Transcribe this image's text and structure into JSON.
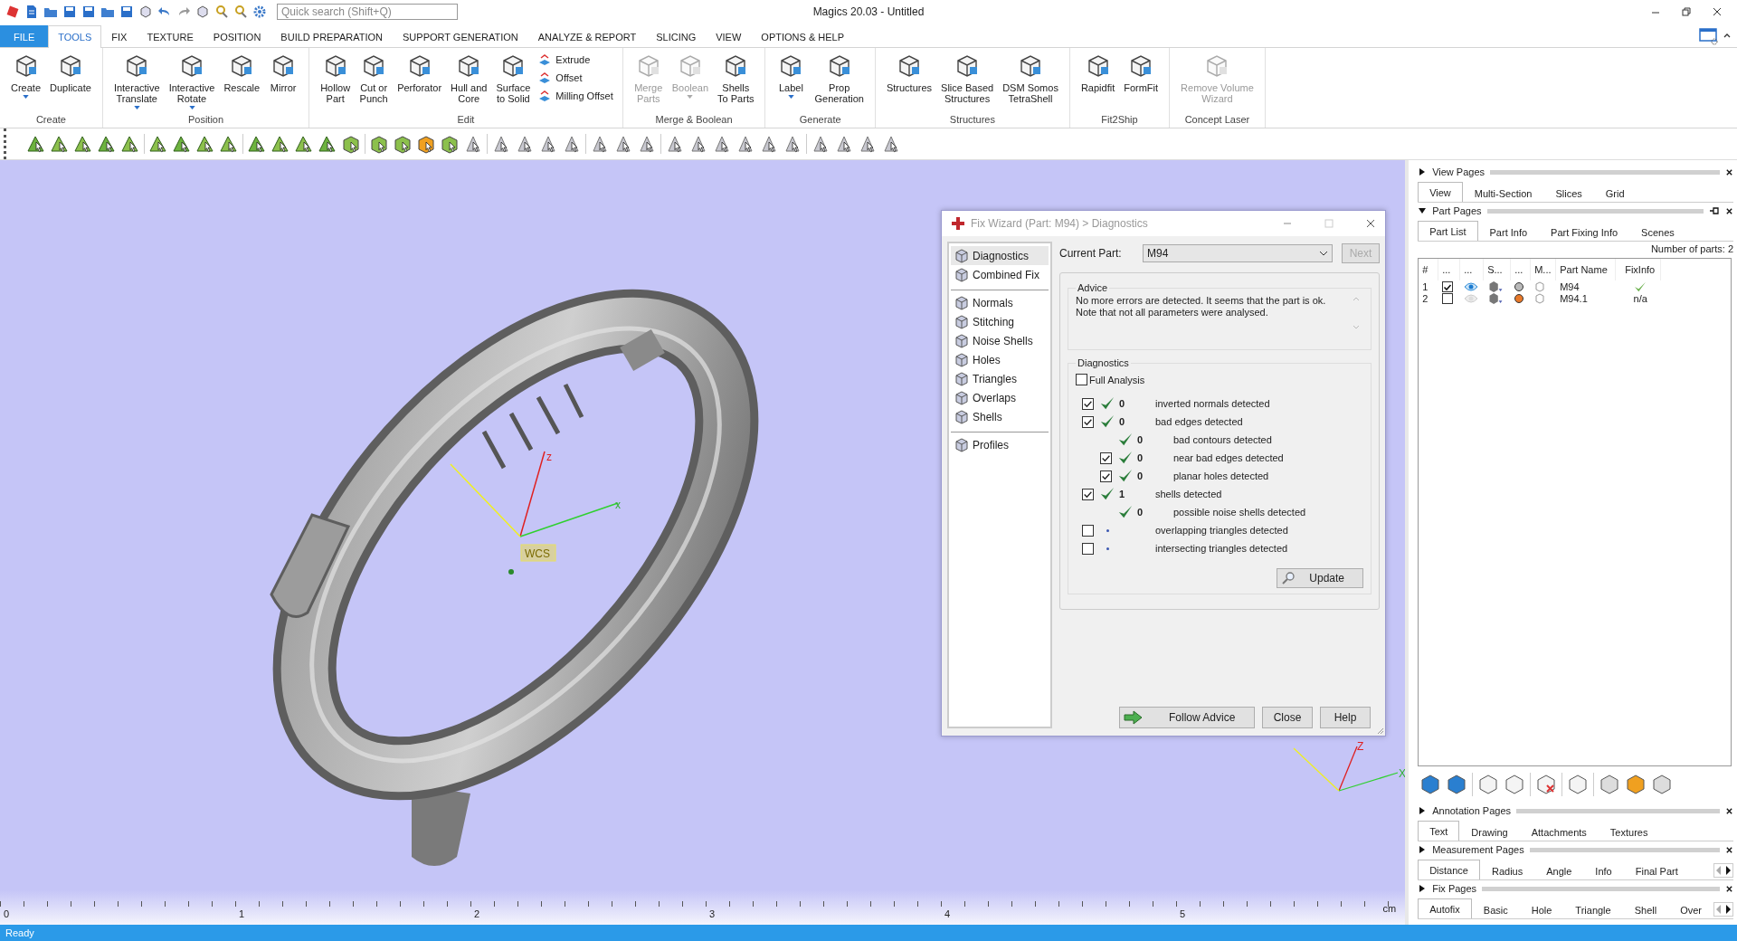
{
  "app": {
    "title": "Magics 20.03 - Untitled",
    "search": {
      "placeholder": "Quick search (Shift+Q)"
    }
  },
  "menu_tabs": [
    {
      "label": "FILE",
      "kind": "file",
      "selected": false
    },
    {
      "label": "TOOLS",
      "kind": "tab",
      "selected": true
    },
    {
      "label": "FIX",
      "kind": "tab",
      "selected": false
    },
    {
      "label": "TEXTURE",
      "kind": "tab",
      "selected": false
    },
    {
      "label": "POSITION",
      "kind": "tab",
      "selected": false
    },
    {
      "label": "BUILD PREPARATION",
      "kind": "tab",
      "selected": false
    },
    {
      "label": "SUPPORT GENERATION",
      "kind": "tab",
      "selected": false
    },
    {
      "label": "ANALYZE & REPORT",
      "kind": "tab",
      "selected": false
    },
    {
      "label": "SLICING",
      "kind": "tab",
      "selected": false
    },
    {
      "label": "VIEW",
      "kind": "tab",
      "selected": false
    },
    {
      "label": "OPTIONS & HELP",
      "kind": "tab",
      "selected": false
    }
  ],
  "ribbon": [
    {
      "label": "Create",
      "buttons": [
        {
          "lines": [
            "Create"
          ],
          "dropdown": true,
          "disabled": false
        },
        {
          "lines": [
            "Duplicate"
          ],
          "dropdown": false,
          "disabled": false
        }
      ]
    },
    {
      "label": "Position",
      "buttons": [
        {
          "lines": [
            "Interactive",
            "Translate"
          ],
          "dropdown": true,
          "disabled": false
        },
        {
          "lines": [
            "Interactive",
            "Rotate"
          ],
          "dropdown": true,
          "disabled": false
        },
        {
          "lines": [
            "Rescale"
          ],
          "dropdown": false,
          "disabled": false
        },
        {
          "lines": [
            "Mirror"
          ],
          "dropdown": false,
          "disabled": false
        }
      ]
    },
    {
      "label": "Edit",
      "buttons": [
        {
          "lines": [
            "Hollow",
            "Part"
          ],
          "dropdown": false,
          "disabled": false
        },
        {
          "lines": [
            "Cut or",
            "Punch"
          ],
          "dropdown": false,
          "disabled": false
        },
        {
          "lines": [
            "Perforator"
          ],
          "dropdown": false,
          "disabled": false
        },
        {
          "lines": [
            "Hull and",
            "Core"
          ],
          "dropdown": false,
          "disabled": false
        },
        {
          "lines": [
            "Surface",
            "to Solid"
          ],
          "dropdown": false,
          "disabled": false
        }
      ],
      "small_buttons": [
        "Extrude",
        "Offset",
        "Milling Offset"
      ]
    },
    {
      "label": "Merge & Boolean",
      "buttons": [
        {
          "lines": [
            "Merge",
            "Parts"
          ],
          "dropdown": false,
          "disabled": true
        },
        {
          "lines": [
            "Boolean"
          ],
          "dropdown": true,
          "disabled": true
        },
        {
          "lines": [
            "Shells",
            "To Parts"
          ],
          "dropdown": false,
          "disabled": false
        }
      ]
    },
    {
      "label": "Generate",
      "buttons": [
        {
          "lines": [
            "Label"
          ],
          "dropdown": true,
          "disabled": false
        },
        {
          "lines": [
            "Prop",
            "Generation"
          ],
          "dropdown": false,
          "disabled": false
        }
      ]
    },
    {
      "label": "Structures",
      "buttons": [
        {
          "lines": [
            "Structures"
          ],
          "dropdown": false,
          "disabled": false
        },
        {
          "lines": [
            "Slice Based",
            "Structures"
          ],
          "dropdown": false,
          "disabled": false
        },
        {
          "lines": [
            "DSM Somos",
            "TetraShell"
          ],
          "dropdown": false,
          "disabled": false
        }
      ]
    },
    {
      "label": "Fit2Ship",
      "buttons": [
        {
          "lines": [
            "Rapidfit"
          ],
          "dropdown": false,
          "disabled": false
        },
        {
          "lines": [
            "FormFit"
          ],
          "dropdown": false,
          "disabled": false
        }
      ]
    },
    {
      "label": "Concept Laser",
      "buttons": [
        {
          "lines": [
            "Remove Volume",
            "Wizard"
          ],
          "dropdown": false,
          "disabled": true
        }
      ]
    }
  ],
  "viewport": {
    "axis_labels": [
      "z",
      "x"
    ],
    "wcs": "WCS",
    "corner_axis_labels": [
      "Z",
      "X"
    ]
  },
  "ruler": {
    "ticks": [
      "0",
      "1",
      "2",
      "3",
      "4",
      "5"
    ],
    "unit": "cm"
  },
  "fix_wizard": {
    "title": "Fix Wizard (Part: M94) > Diagnostics",
    "nav": [
      [
        {
          "label": "Diagnostics",
          "selected": true
        },
        {
          "label": "Combined Fix",
          "selected": false
        }
      ],
      [
        {
          "label": "Normals",
          "selected": false
        },
        {
          "label": "Stitching",
          "selected": false
        },
        {
          "label": "Noise Shells",
          "selected": false
        },
        {
          "label": "Holes",
          "selected": false
        },
        {
          "label": "Triangles",
          "selected": false
        },
        {
          "label": "Overlaps",
          "selected": false
        },
        {
          "label": "Shells",
          "selected": false
        }
      ],
      [
        {
          "label": "Profiles",
          "selected": false
        }
      ]
    ],
    "current_part_label": "Current Part:",
    "current_part": "M94",
    "next_button": {
      "label": "Next",
      "disabled": true
    },
    "advice_title": "Advice",
    "advice_lines": [
      "No more errors are detected. It seems that the part is ok.",
      "Note that not all parameters were analysed."
    ],
    "diagnostics_title": "Diagnostics",
    "full_analysis": {
      "label": "Full Analysis",
      "checked": false
    },
    "items": [
      {
        "kind": "checkbox",
        "checked": true,
        "analysed": true,
        "count": "0",
        "label": "inverted normals detected"
      },
      {
        "kind": "checkbox",
        "checked": true,
        "analysed": true,
        "count": "0",
        "label": "bad edges detected",
        "children": [
          {
            "kind": "info",
            "analysed": true,
            "count": "0",
            "label": "bad contours detected"
          },
          {
            "kind": "checkbox",
            "checked": true,
            "analysed": true,
            "count": "0",
            "label": "near bad edges detected"
          },
          {
            "kind": "checkbox",
            "checked": true,
            "analysed": true,
            "count": "0",
            "label": "planar holes detected"
          }
        ]
      },
      {
        "kind": "checkbox",
        "checked": true,
        "analysed": true,
        "count": "1",
        "label": "shells detected",
        "children": [
          {
            "kind": "info",
            "analysed": true,
            "count": "0",
            "label": "possible noise shells detected"
          }
        ]
      },
      {
        "kind": "checkbox",
        "checked": false,
        "analysed": false,
        "label": "overlapping triangles detected"
      },
      {
        "kind": "checkbox",
        "checked": false,
        "analysed": false,
        "label": "intersecting triangles detected"
      }
    ],
    "update_button": "Update",
    "buttons": [
      "Follow Advice",
      "Close",
      "Help"
    ]
  },
  "side_panel": {
    "sections": [
      {
        "title": "View Pages",
        "expanded": false,
        "pin": false,
        "scroll": false,
        "tabs": [
          {
            "label": "View",
            "selected": true
          },
          {
            "label": "Multi-Section",
            "selected": false
          },
          {
            "label": "Slices",
            "selected": false
          },
          {
            "label": "Grid",
            "selected": false
          }
        ]
      },
      {
        "title": "Part Pages",
        "expanded": true,
        "pin": true,
        "scroll": false,
        "tabs": [
          {
            "label": "Part List",
            "selected": true
          },
          {
            "label": "Part Info",
            "selected": false
          },
          {
            "label": "Part Fixing Info",
            "selected": false
          },
          {
            "label": "Scenes",
            "selected": false
          }
        ],
        "part_count": "Number of parts: 2",
        "columns": [
          "#",
          "...",
          "...",
          "S...",
          "...",
          "M...",
          "Part Name",
          "FixInfo"
        ],
        "rows": [
          {
            "num": "1",
            "checked": true,
            "visible": true,
            "color": "#b9b9b9",
            "name": "M94",
            "fix_ok": true
          },
          {
            "num": "2",
            "checked": false,
            "visible": false,
            "color": "#e8792a",
            "name": "M94.1",
            "fix_ok": false,
            "fix_text": "n/a"
          }
        ]
      },
      {
        "title": "Annotation Pages",
        "expanded": false,
        "pin": false,
        "scroll": false,
        "tabs": [
          {
            "label": "Text",
            "selected": true
          },
          {
            "label": "Drawing",
            "selected": false
          },
          {
            "label": "Attachments",
            "selected": false
          },
          {
            "label": "Textures",
            "selected": false
          }
        ]
      },
      {
        "title": "Measurement Pages",
        "expanded": false,
        "pin": false,
        "scroll": true,
        "tabs": [
          {
            "label": "Distance",
            "selected": true
          },
          {
            "label": "Radius",
            "selected": false
          },
          {
            "label": "Angle",
            "selected": false
          },
          {
            "label": "Info",
            "selected": false
          },
          {
            "label": "Final Part",
            "selected": false
          }
        ]
      },
      {
        "title": "Fix Pages",
        "expanded": false,
        "pin": false,
        "scroll": true,
        "tabs": [
          {
            "label": "Autofix",
            "selected": true
          },
          {
            "label": "Basic",
            "selected": false
          },
          {
            "label": "Hole",
            "selected": false
          },
          {
            "label": "Triangle",
            "selected": false
          },
          {
            "label": "Shell",
            "selected": false
          },
          {
            "label": "Over",
            "selected": false
          }
        ]
      }
    ]
  },
  "status_bar": "Ready"
}
